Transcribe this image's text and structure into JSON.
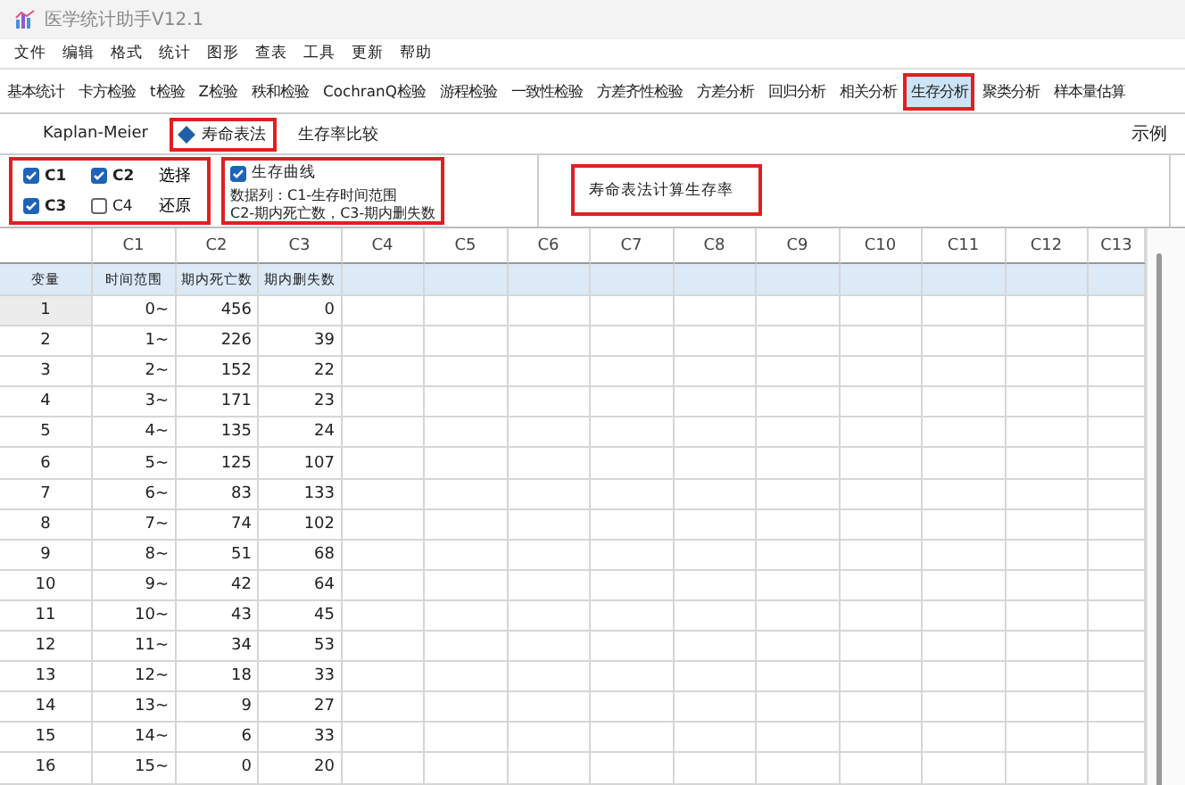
{
  "window": {
    "title": "医学统计助手V12.1"
  },
  "menu": [
    "文件",
    "编辑",
    "格式",
    "统计",
    "图形",
    "查表",
    "工具",
    "更新",
    "帮助"
  ],
  "toolbar": [
    {
      "label": "基本统计",
      "selected": false
    },
    {
      "label": "卡方检验",
      "selected": false
    },
    {
      "label": "t检验",
      "selected": false
    },
    {
      "label": "Z检验",
      "selected": false
    },
    {
      "label": "秩和检验",
      "selected": false
    },
    {
      "label": "CochranQ检验",
      "selected": false
    },
    {
      "label": "游程检验",
      "selected": false
    },
    {
      "label": "一致性检验",
      "selected": false
    },
    {
      "label": "方差齐性检验",
      "selected": false
    },
    {
      "label": "方差分析",
      "selected": false
    },
    {
      "label": "回归分析",
      "selected": false
    },
    {
      "label": "相关分析",
      "selected": false
    },
    {
      "label": "生存分析",
      "selected": true
    },
    {
      "label": "聚类分析",
      "selected": false
    },
    {
      "label": "样本量估算",
      "selected": false
    }
  ],
  "subtabs": [
    {
      "label": "Kaplan-Meier",
      "selected": false
    },
    {
      "label": "寿命表法",
      "selected": true
    },
    {
      "label": "生存率比较",
      "selected": false
    }
  ],
  "example_link": "示例",
  "columns_box": {
    "checkboxes": [
      {
        "label": "C1",
        "checked": true
      },
      {
        "label": "C2",
        "checked": true
      },
      {
        "label": "C3",
        "checked": true
      },
      {
        "label": "C4",
        "checked": false
      }
    ],
    "select_button": "选择",
    "restore_button": "还原"
  },
  "survival_curve": {
    "label": "生存曲线",
    "checked": true
  },
  "data_note": [
    "数据列：C1-生存时间范围",
    "C2-期内死亡数，C3-期内删失数"
  ],
  "description": "寿命表法计算生存率",
  "grid": {
    "columns": [
      "C1",
      "C2",
      "C3",
      "C4",
      "C5",
      "C6",
      "C7",
      "C8",
      "C9",
      "C10",
      "C11",
      "C12",
      "C13"
    ],
    "row_header": "变量",
    "variable_names": [
      "时间范围",
      "期内死亡数",
      "期内删失数"
    ],
    "rows": [
      {
        "index": "1",
        "selected": true,
        "cells": [
          "0~",
          "456",
          "0"
        ]
      },
      {
        "index": "2",
        "selected": false,
        "cells": [
          "1~",
          "226",
          "39"
        ]
      },
      {
        "index": "3",
        "selected": false,
        "cells": [
          "2~",
          "152",
          "22"
        ]
      },
      {
        "index": "4",
        "selected": false,
        "cells": [
          "3~",
          "171",
          "23"
        ]
      },
      {
        "index": "5",
        "selected": false,
        "cells": [
          "4~",
          "135",
          "24"
        ]
      },
      {
        "index": "6",
        "selected": false,
        "cells": [
          "5~",
          "125",
          "107"
        ]
      },
      {
        "index": "7",
        "selected": false,
        "cells": [
          "6~",
          "83",
          "133"
        ]
      },
      {
        "index": "8",
        "selected": false,
        "cells": [
          "7~",
          "74",
          "102"
        ]
      },
      {
        "index": "9",
        "selected": false,
        "cells": [
          "8~",
          "51",
          "68"
        ]
      },
      {
        "index": "10",
        "selected": false,
        "cells": [
          "9~",
          "42",
          "64"
        ]
      },
      {
        "index": "11",
        "selected": false,
        "cells": [
          "10~",
          "43",
          "45"
        ]
      },
      {
        "index": "12",
        "selected": false,
        "cells": [
          "11~",
          "34",
          "53"
        ]
      },
      {
        "index": "13",
        "selected": false,
        "cells": [
          "12~",
          "18",
          "33"
        ]
      },
      {
        "index": "14",
        "selected": false,
        "cells": [
          "13~",
          "9",
          "27"
        ]
      },
      {
        "index": "15",
        "selected": false,
        "cells": [
          "14~",
          "6",
          "33"
        ]
      },
      {
        "index": "16",
        "selected": false,
        "cells": [
          "15~",
          "0",
          "20"
        ]
      }
    ]
  }
}
